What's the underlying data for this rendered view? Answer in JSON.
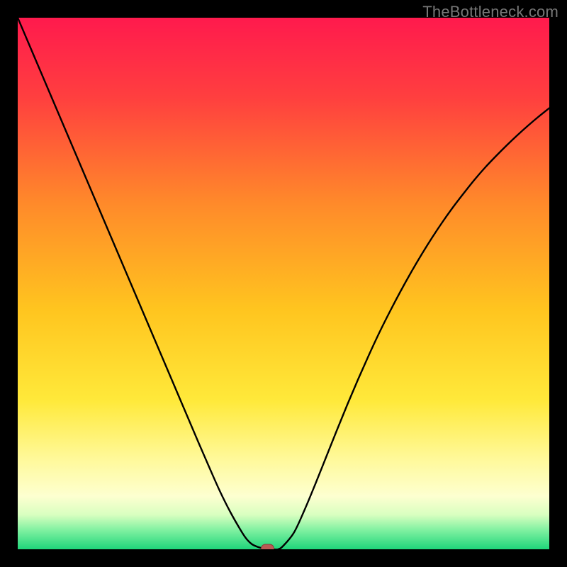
{
  "watermark": "TheBottleneck.com",
  "colors": {
    "frame": "#000000",
    "curve": "#000000",
    "marker_fill": "#bb5a55",
    "marker_stroke": "#8b3e3a",
    "gradient_stops": [
      {
        "offset": 0.0,
        "color": "#ff1a4d"
      },
      {
        "offset": 0.15,
        "color": "#ff3f3f"
      },
      {
        "offset": 0.35,
        "color": "#ff8a2a"
      },
      {
        "offset": 0.55,
        "color": "#ffc51f"
      },
      {
        "offset": 0.72,
        "color": "#ffe93a"
      },
      {
        "offset": 0.83,
        "color": "#fff99a"
      },
      {
        "offset": 0.9,
        "color": "#fdffd0"
      },
      {
        "offset": 0.935,
        "color": "#d9ffc0"
      },
      {
        "offset": 0.965,
        "color": "#7df0a0"
      },
      {
        "offset": 1.0,
        "color": "#1fd67a"
      }
    ]
  },
  "chart_data": {
    "type": "line",
    "title": "",
    "xlabel": "",
    "ylabel": "",
    "xlim": [
      0,
      100
    ],
    "ylim": [
      0,
      100
    ],
    "x": [
      0,
      2,
      4,
      6,
      8,
      10,
      12,
      14,
      16,
      18,
      20,
      22,
      24,
      26,
      28,
      30,
      32,
      34,
      36,
      38,
      40,
      42,
      43,
      44,
      45,
      46,
      47,
      48,
      49,
      50,
      52,
      54,
      56,
      58,
      60,
      62,
      64,
      66,
      68,
      70,
      72,
      74,
      76,
      78,
      80,
      82,
      84,
      86,
      88,
      90,
      92,
      94,
      96,
      98,
      100
    ],
    "values": [
      100,
      95.3,
      90.6,
      85.9,
      81.2,
      76.5,
      71.8,
      67.1,
      62.4,
      57.7,
      53,
      48.3,
      43.6,
      38.9,
      34.2,
      29.5,
      24.8,
      20.1,
      15.5,
      11,
      7,
      3.5,
      2,
      1,
      0.5,
      0.2,
      0,
      0,
      0,
      0.7,
      3.2,
      7.5,
      12.3,
      17.3,
      22.3,
      27.2,
      31.9,
      36.4,
      40.7,
      44.7,
      48.5,
      52.1,
      55.5,
      58.7,
      61.7,
      64.5,
      67.1,
      69.6,
      71.9,
      74,
      76,
      77.9,
      79.7,
      81.4,
      83
    ],
    "marker": {
      "x": 47,
      "y": 0
    },
    "grid": false,
    "legend": false
  }
}
